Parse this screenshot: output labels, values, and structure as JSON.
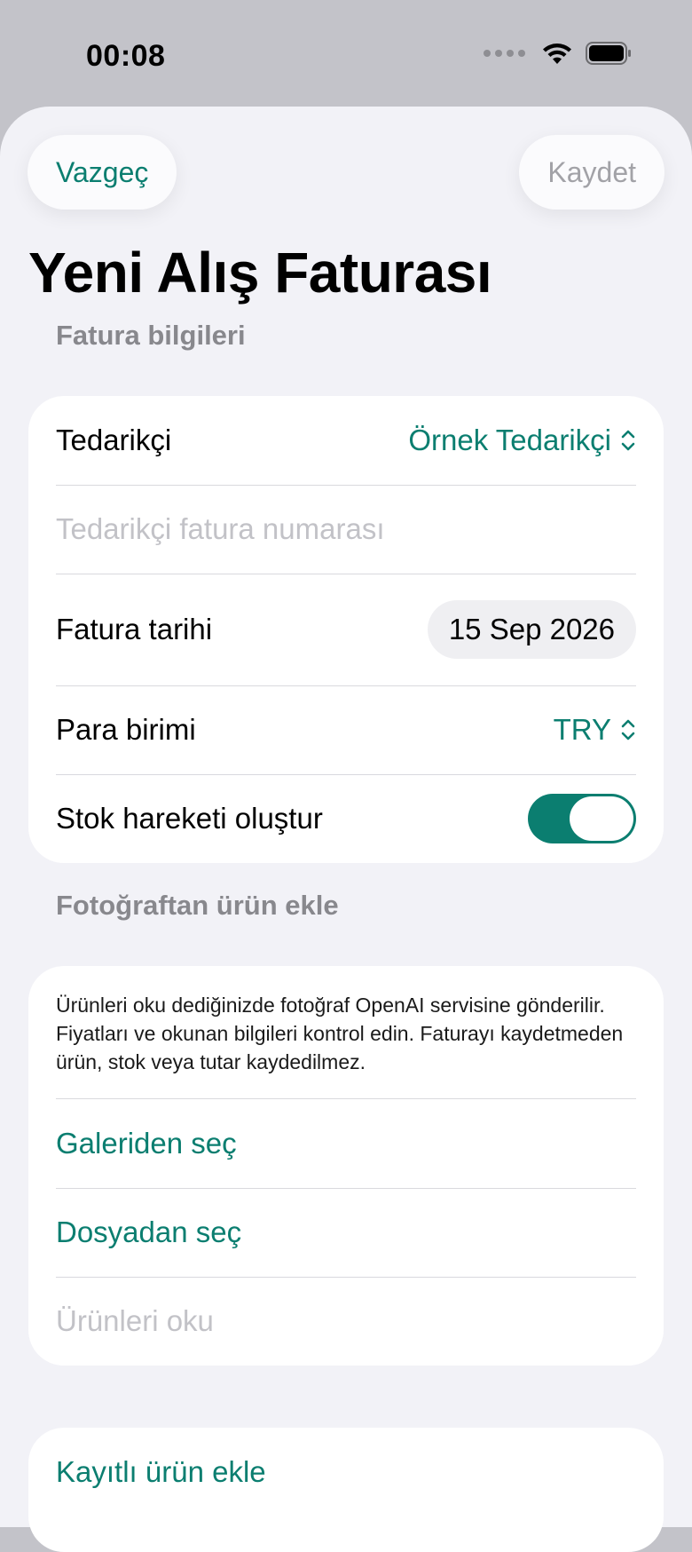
{
  "status_bar": {
    "time": "00:08"
  },
  "nav": {
    "cancel_label": "Vazgeç",
    "save_label": "Kaydet"
  },
  "page_title": "Yeni Alış Faturası",
  "invoice_section": {
    "header": "Fatura bilgileri",
    "supplier_label": "Tedarikçi",
    "supplier_value": "Örnek Tedarikçi",
    "invoice_number_placeholder": "Tedarikçi fatura numarası",
    "date_label": "Fatura tarihi",
    "date_value": "15 Sep 2026",
    "currency_label": "Para birimi",
    "currency_value": "TRY",
    "stock_label": "Stok hareketi oluştur",
    "stock_enabled": true
  },
  "photo_section": {
    "header": "Fotoğraftan ürün ekle",
    "info_text": "Ürünleri oku dediğinizde fotoğraf OpenAI servisine gönderilir. Fiyatları ve okunan bilgileri kontrol edin. Faturayı kaydetmeden ürün, stok veya tutar kaydedilmez.",
    "gallery_label": "Galeriden seç",
    "file_label": "Dosyadan seç",
    "read_label": "Ürünleri oku"
  },
  "products_section": {
    "add_saved_label": "Kayıtlı ürün ekle"
  },
  "colors": {
    "accent": "#0b7e70",
    "background": "#f2f2f7",
    "disabled": "#c2c2c7"
  },
  "icons": [
    "wifi-icon",
    "battery-icon",
    "signal-dots-icon",
    "chevron-updown-icon"
  ]
}
